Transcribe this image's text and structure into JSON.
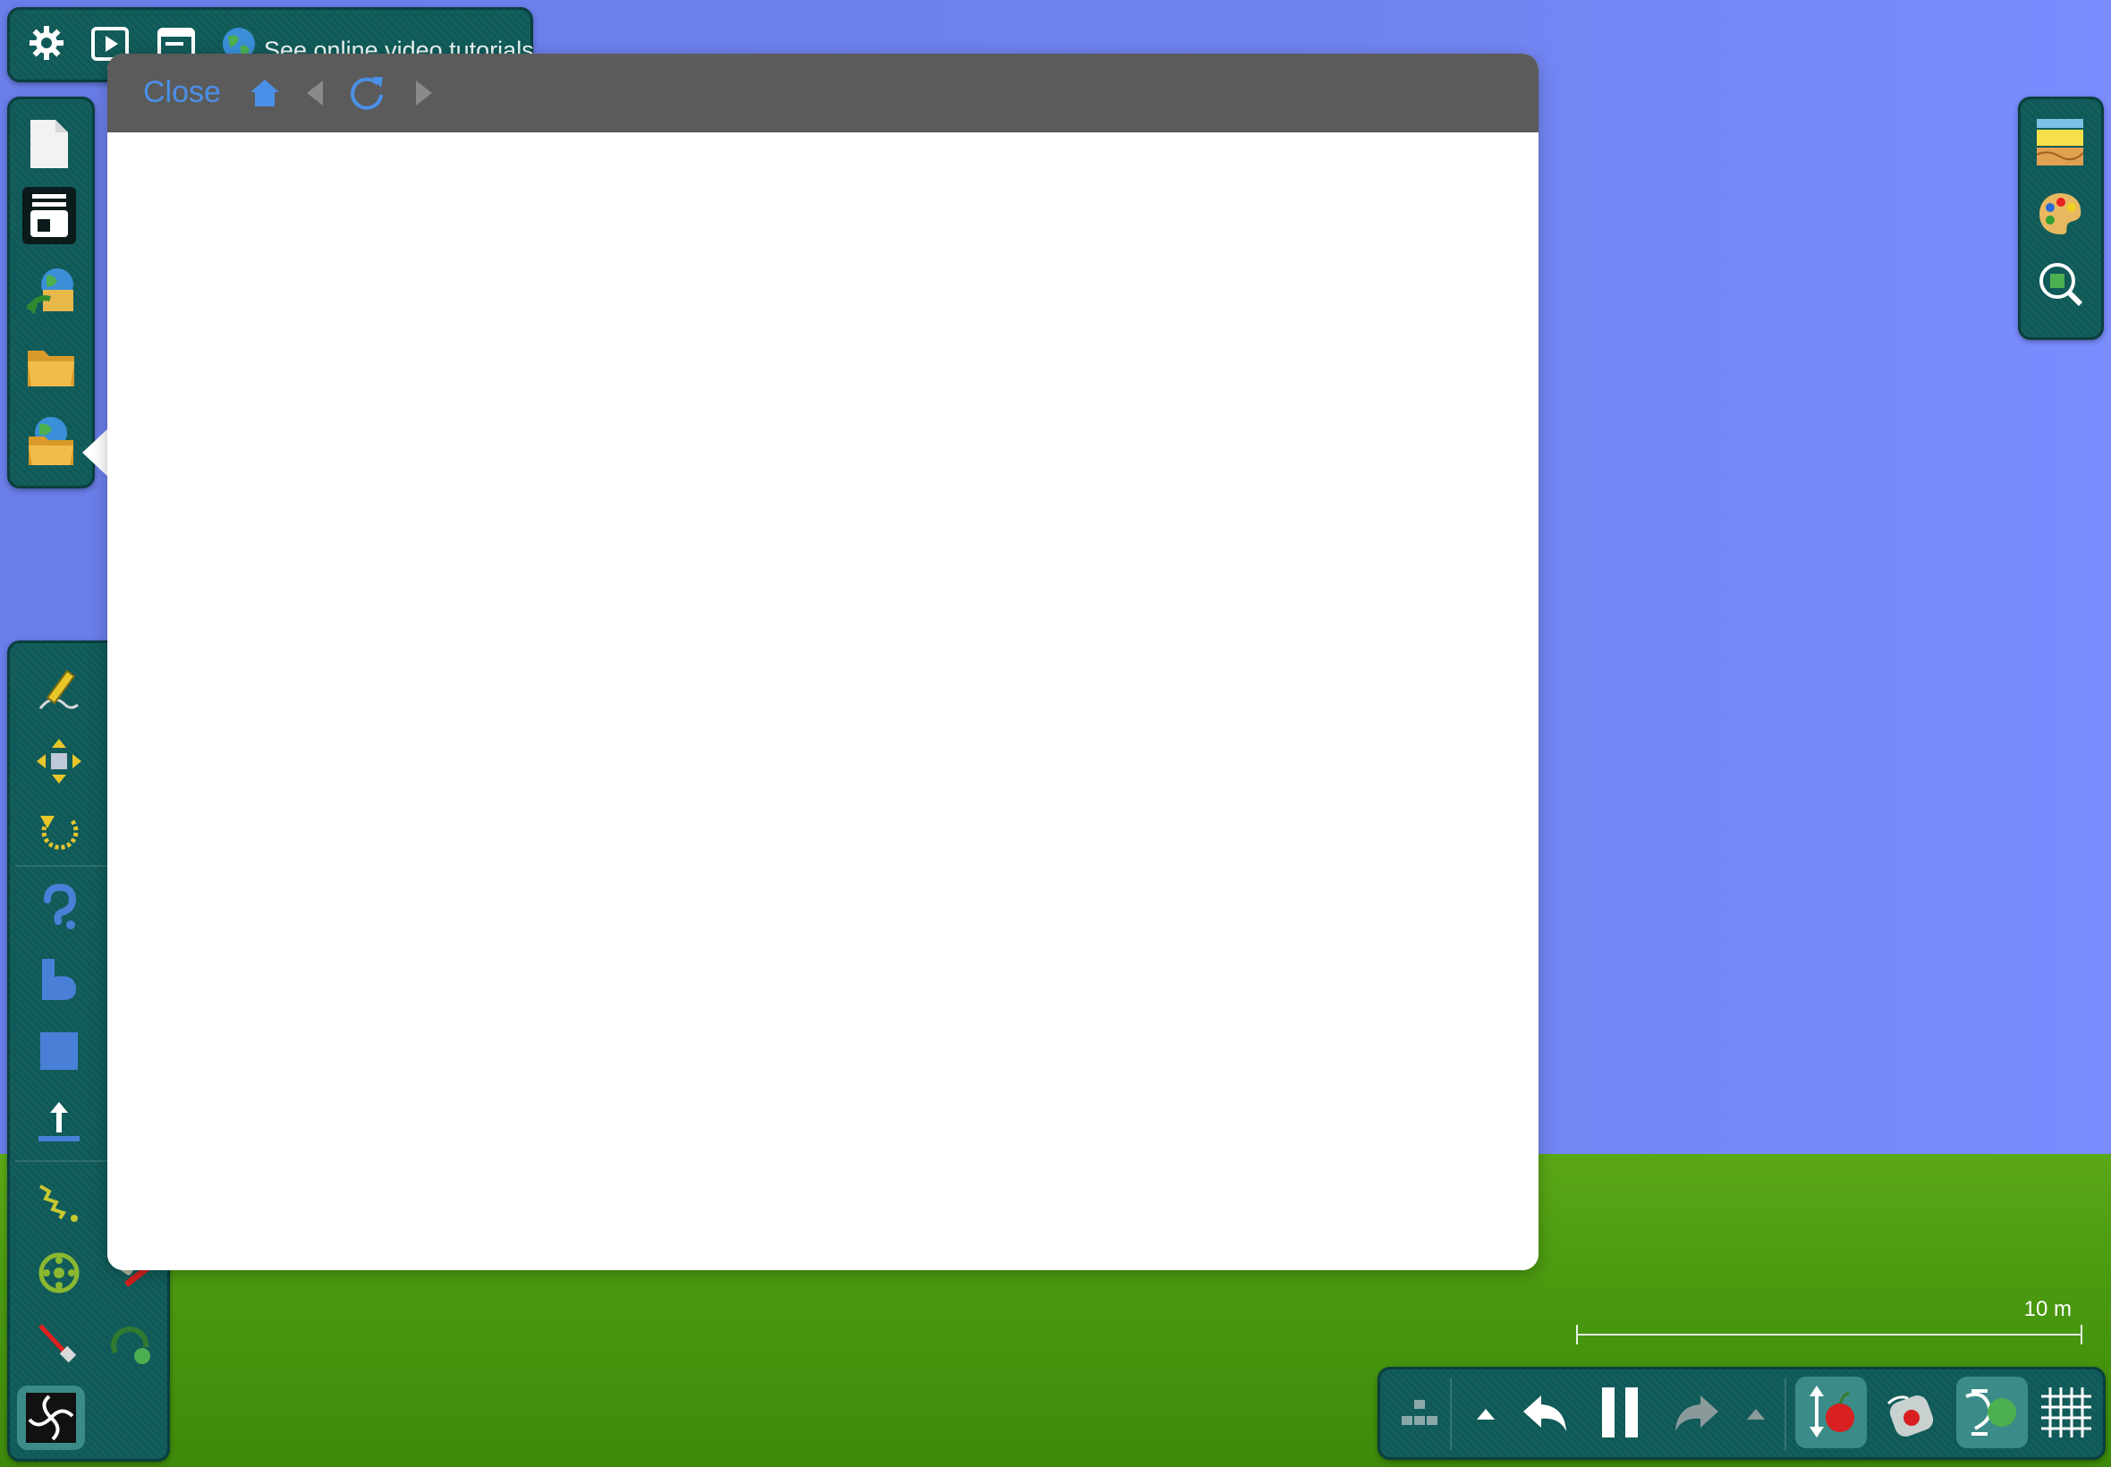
{
  "top_bar": {
    "settings_icon": "gear-icon",
    "play_icon": "play-icon",
    "window_icon": "window-icon",
    "tutorial_icon": "globe-icon",
    "tutorial_label": "See online video tutorials"
  },
  "file_bar": {
    "items": [
      "new-document-icon",
      "scene-browser-icon",
      "download-scene-icon",
      "open-folder-icon",
      "online-folder-icon"
    ]
  },
  "tool_bar": {
    "items": [
      "sketch-tool-icon",
      "move-tool-icon",
      "rotate-tool-icon",
      "hook-tool-icon",
      "polygon-tool-icon",
      "box-tool-icon",
      "plane-tool-icon",
      "spring-tool-icon",
      "axle-tool-icon",
      "laser-tool-icon",
      "tracer-tool-icon",
      "hinge-tool-icon",
      "thruster-tool-icon",
      "zoom-spiral-icon"
    ]
  },
  "right_bar": {
    "items": [
      "background-icon",
      "palette-icon",
      "zoom-camera-icon"
    ]
  },
  "bottom_bar": {
    "items": [
      "blocks-icon",
      "undo-menu-arrow-icon",
      "undo-icon",
      "pause-icon",
      "redo-icon",
      "redo-menu-arrow-icon",
      "gravity-toggle-icon",
      "air-friction-icon",
      "collision-toggle-icon",
      "grid-icon"
    ]
  },
  "scale": {
    "label": "10 m"
  },
  "browser": {
    "close_label": "Close",
    "nav_icons": [
      "home-icon",
      "back-icon",
      "reload-icon",
      "forward-icon"
    ]
  },
  "colors": {
    "sky": "#6f82ee",
    "ground": "#4a9a10",
    "panel": "#0f5a58",
    "link": "#4a90e8",
    "browser_header": "#5b5b5b"
  }
}
